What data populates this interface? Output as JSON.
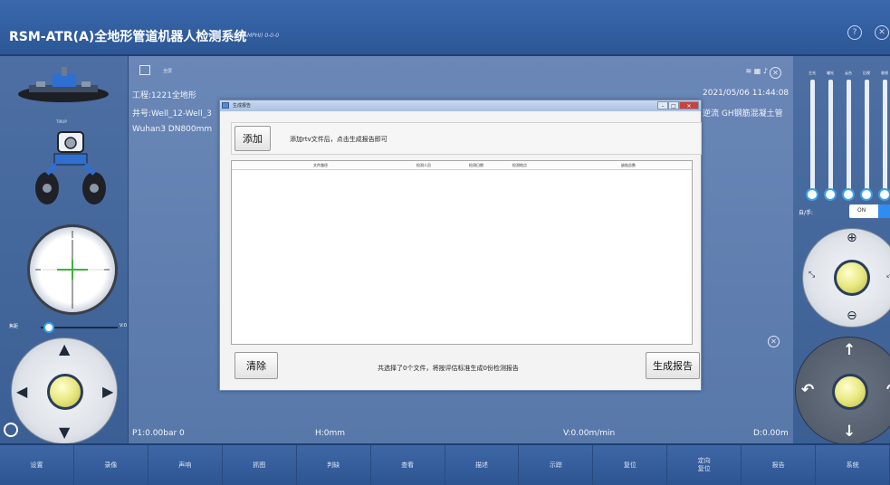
{
  "app": {
    "title": "RSM-ATR(A)全地形管道机器人检测系统",
    "version": "V1.0.20922 (AMPHI) 0-0-0"
  },
  "left_panel": {
    "robot_label": "TIRUP",
    "zoom_label": "焦距",
    "zoom_value_label": "V:0"
  },
  "center": {
    "fullscreen_label": "全屏",
    "project_line": "工程:1221全地形",
    "well_line": "井号:Well_12-Well_3",
    "pipe_line": "Wuhan3 DN800mm",
    "datetime": "2021/05/06 11:44:08",
    "flow_text": "逆流 GH钢筋混凝土管",
    "readout_pressure": "P1:0.00bar 0",
    "readout_height": "H:0mm",
    "readout_speed": "V:0.00m/min",
    "readout_distance": "D:0.00m"
  },
  "right_panel": {
    "sliders": [
      {
        "label": "主光"
      },
      {
        "label": "辅光"
      },
      {
        "label": "云台"
      },
      {
        "label": "后视"
      },
      {
        "label": "收线"
      }
    ],
    "auto_manual_label": "自/手:",
    "toggle_label": "ON"
  },
  "dialog": {
    "title": "生成报告",
    "add_button": "添加",
    "hint": "添加rtv文件后，点击生成报告即可",
    "columns": [
      "文件路径",
      "检测人员",
      "检测日期",
      "检测地点",
      "缺陷总数"
    ],
    "rows": [],
    "clear_button": "清除",
    "summary": "共选择了0个文件，将按评估标准生成0份检测报告",
    "generate_button": "生成报告"
  },
  "toolbar": {
    "items": [
      "设置",
      "录像",
      "声响",
      "抓图",
      "判缺",
      "查看",
      "描述",
      "示踪",
      "复位",
      "定向\n复位",
      "报告",
      "系统"
    ]
  },
  "colors": {
    "background": "#2a4f86",
    "accent": "#3aa0e8",
    "close_red": "#c9433a"
  }
}
